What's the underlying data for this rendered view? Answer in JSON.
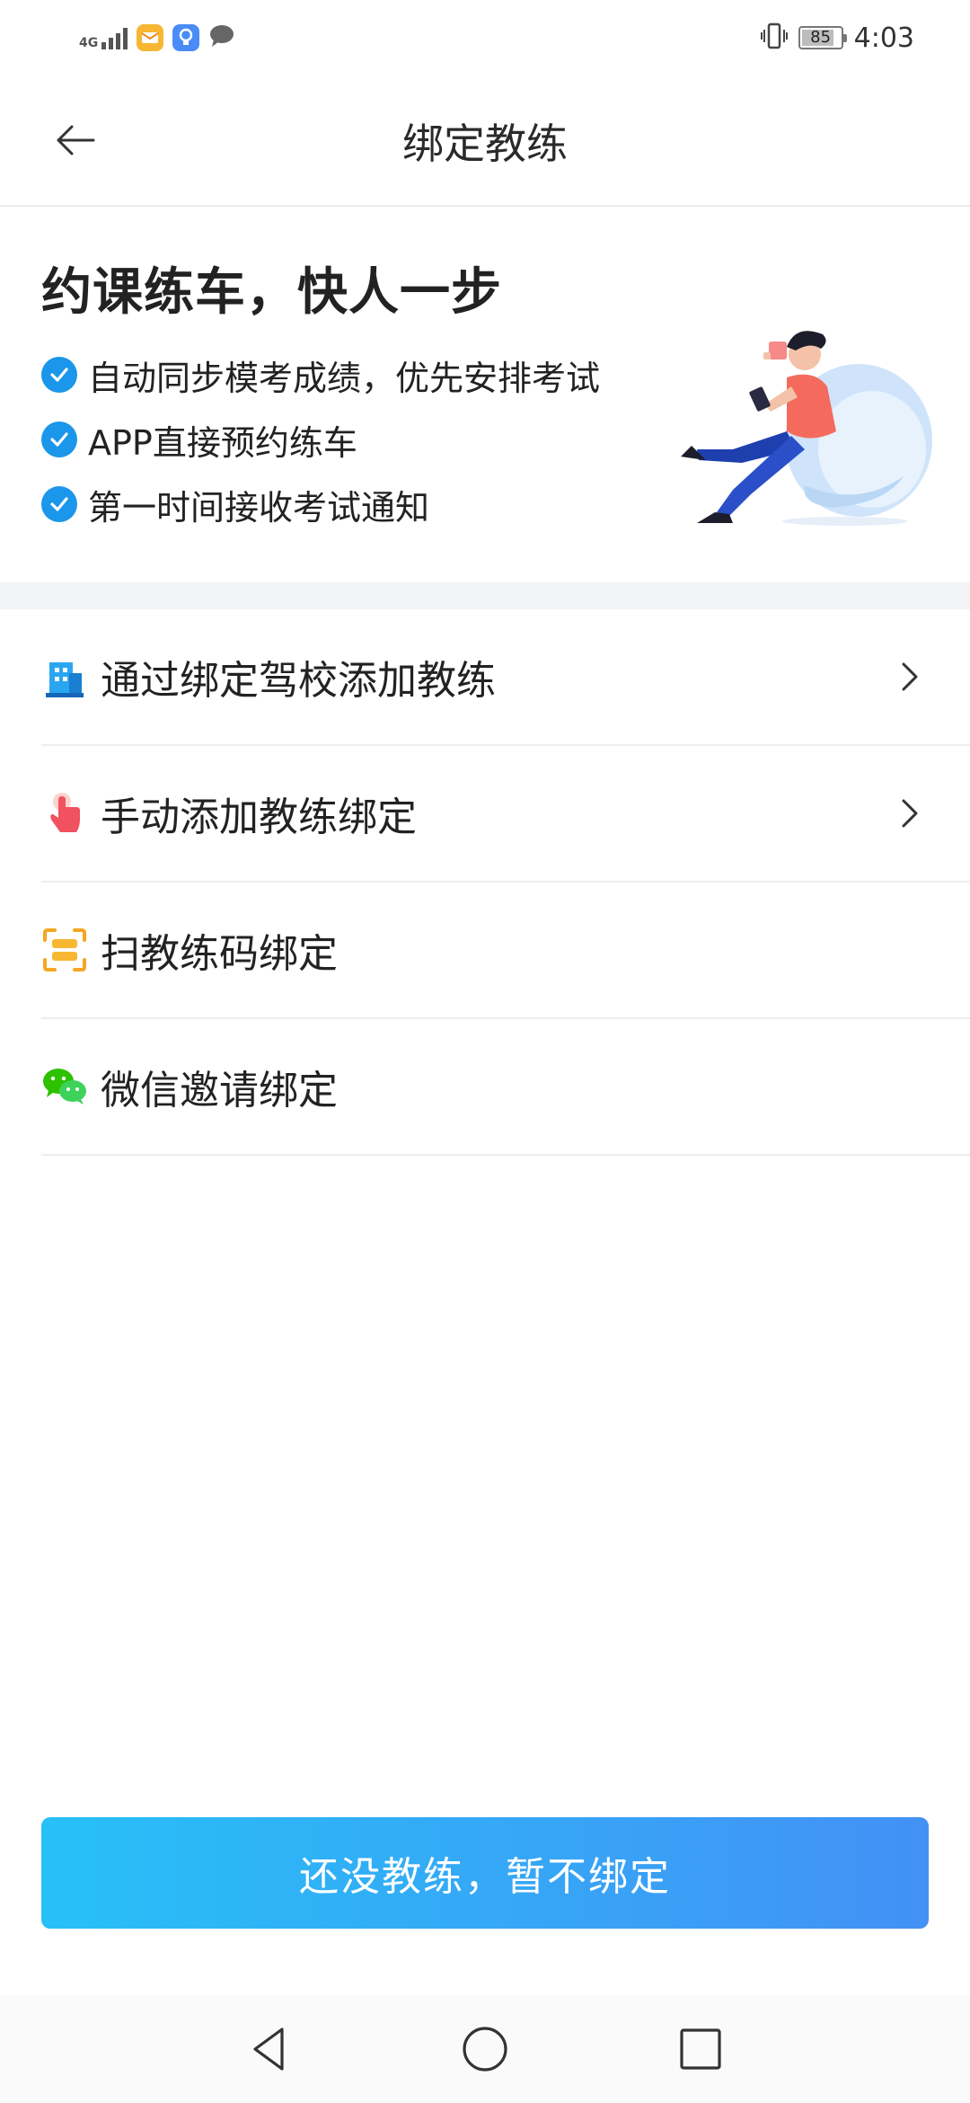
{
  "status_bar": {
    "network": "4G",
    "battery_level": "85",
    "time": "4:03",
    "icons": [
      "signal-icon",
      "mail-app-icon",
      "bulb-app-icon",
      "chat-app-icon",
      "vibrate-icon",
      "battery-icon"
    ]
  },
  "header": {
    "title": "绑定教练",
    "back_icon": "arrow-left-icon"
  },
  "promo": {
    "headline": "约课练车，快人一步",
    "features": [
      "自动同步模考成绩，优先安排考试",
      "APP直接预约练车",
      "第一时间接收考试通知"
    ],
    "illustration": "person-sitting-in-bean-bag-illustration"
  },
  "options": [
    {
      "label": "通过绑定驾校添加教练",
      "icon": "building-icon",
      "has_chevron": true
    },
    {
      "label": "手动添加教练绑定",
      "icon": "hand-tap-icon",
      "has_chevron": true
    },
    {
      "label": "扫教练码绑定",
      "icon": "scan-icon",
      "has_chevron": false
    },
    {
      "label": "微信邀请绑定",
      "icon": "wechat-icon",
      "has_chevron": false
    }
  ],
  "cta": {
    "label": "还没教练，暂不绑定"
  },
  "nav": {
    "icons": [
      "back-triangle-icon",
      "home-circle-icon",
      "recents-square-icon"
    ]
  },
  "colors": {
    "accent": "#1a96ea",
    "cta_start": "#27c0f7",
    "cta_end": "#4391f5"
  }
}
